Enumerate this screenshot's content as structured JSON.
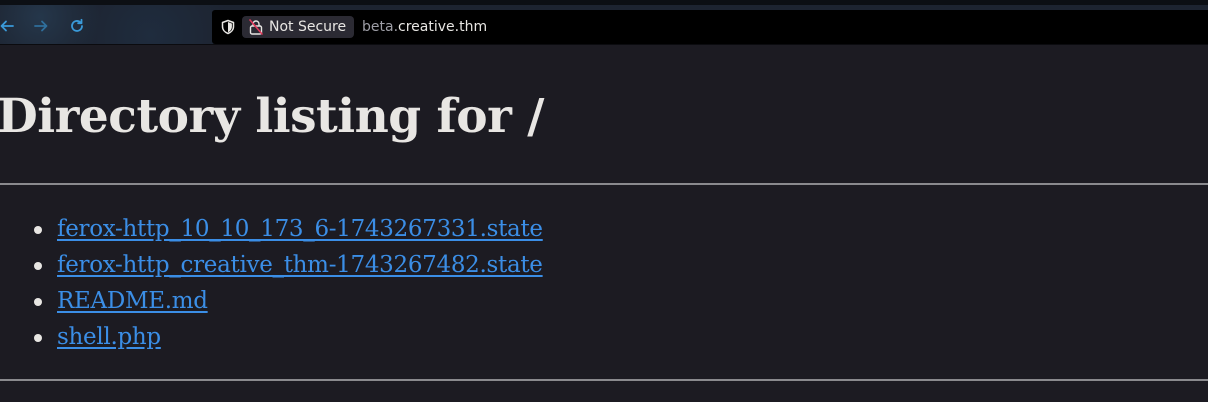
{
  "browser": {
    "nav": {
      "back_icon": "arrow-left-icon",
      "forward_icon": "arrow-right-icon",
      "reload_icon": "reload-icon"
    },
    "urlbar": {
      "shield_icon": "shield-icon",
      "lock_icon": "insecure-lock-icon",
      "security_label": "Not Secure",
      "url_subdomain": "beta.",
      "url_host": "creative.thm"
    }
  },
  "page": {
    "title": "Directory listing for /",
    "files": [
      {
        "name": "ferox-http_10_10_173_6-1743267331.state"
      },
      {
        "name": "ferox-http_creative_thm-1743267482.state"
      },
      {
        "name": "README.md"
      },
      {
        "name": "shell.php"
      }
    ]
  },
  "colors": {
    "background": "#1c1b22",
    "text": "#e8e6e3",
    "link": "#3b8ee6",
    "accent": "#3a9ad9"
  }
}
